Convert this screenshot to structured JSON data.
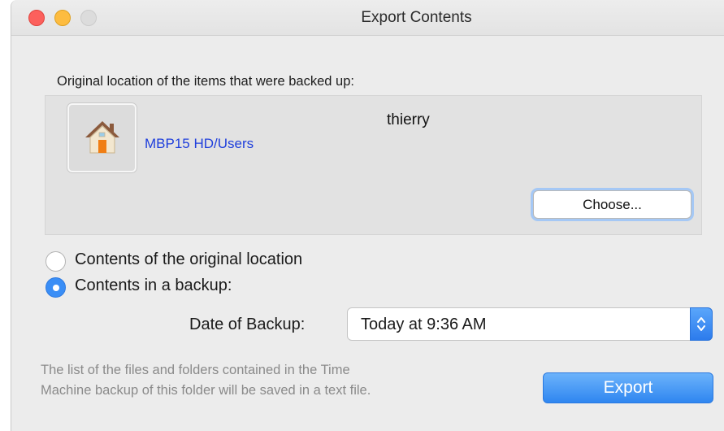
{
  "window": {
    "title": "Export Contents",
    "traffic_lights": [
      "close",
      "minimize",
      "zoom-disabled"
    ]
  },
  "original_location": {
    "heading": "Original location of the items that were backed up:",
    "icon": "home-folder-icon",
    "path": "MBP15 HD/Users",
    "folder_name": "thierry",
    "choose_label": "Choose..."
  },
  "options": {
    "original_label": "Contents of the original location",
    "original_selected": false,
    "backup_label": "Contents in a backup:",
    "backup_selected": true
  },
  "date_of_backup": {
    "label": "Date of Backup:",
    "value": "Today at 9:36 AM"
  },
  "info": {
    "line1": "The list of the files and folders contained in the Time",
    "line2": "Machine backup of this folder will be saved in a text file."
  },
  "export_label": "Export",
  "colors": {
    "accent": "#3a8ef6",
    "link": "#1f3fdc"
  }
}
